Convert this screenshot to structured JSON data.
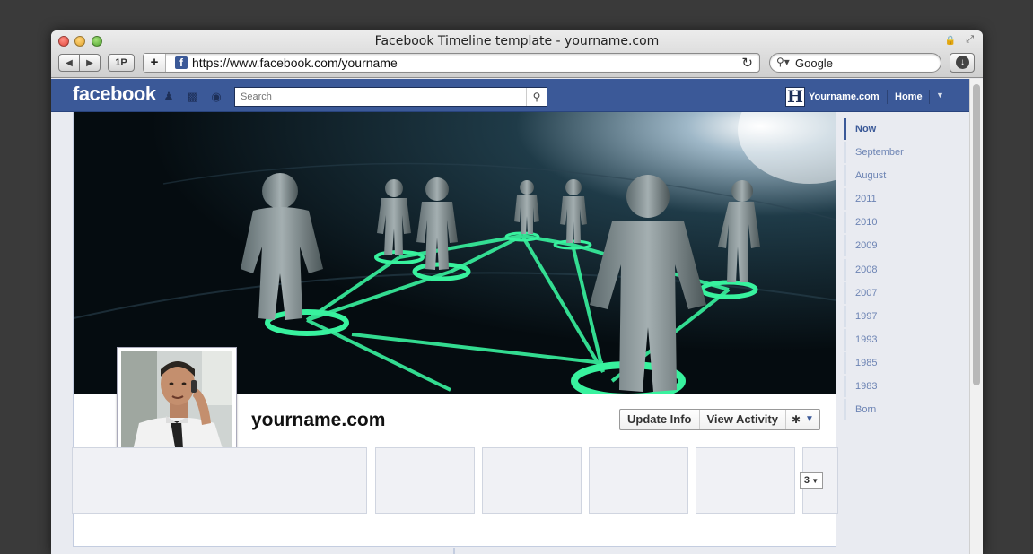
{
  "browser": {
    "window_title": "Facebook Timeline template - yourname.com",
    "url": "https://www.facebook.com/yourname",
    "search_placeholder": "Google",
    "onepassword_label": "1P",
    "new_tab_label": "+",
    "favicon_letter": "f",
    "icons": [
      "back-arrow-icon",
      "forward-arrow-icon",
      "reload-icon",
      "magnifier-icon",
      "download-icon",
      "lock-icon",
      "resize-icon"
    ]
  },
  "facebook_bar": {
    "logo": "facebook",
    "search_placeholder": "Search",
    "user_name": "Yourname.com",
    "user_initial": "H",
    "home_label": "Home",
    "brand_color": "#3b5998"
  },
  "profile": {
    "name": "yourname.com",
    "actions": {
      "update_info": "Update Info",
      "view_activity": "View Activity"
    },
    "more_count": "3"
  },
  "scrubber": {
    "items": [
      "Now",
      "September",
      "August",
      "2011",
      "2010",
      "2009",
      "2008",
      "2007",
      "1997",
      "1993",
      "1985",
      "1983",
      "Born"
    ],
    "active_index": 0
  }
}
